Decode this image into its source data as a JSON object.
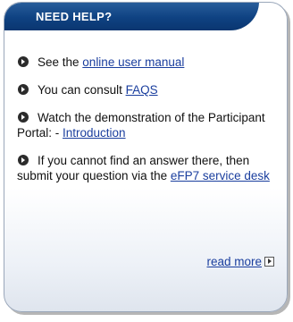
{
  "box": {
    "title": "NEED HELP?",
    "items": [
      {
        "text": "See the ",
        "link": "online user manual",
        "after": ""
      },
      {
        "text": "You can consult ",
        "link": "FAQS",
        "after": ""
      },
      {
        "text": "Watch the demonstration of the Participant Portal: - ",
        "link": "Introduction",
        "after": ""
      },
      {
        "text": "If you cannot find an answer there, then submit your question via the ",
        "link": "eFP7 service desk",
        "after": ""
      }
    ],
    "read_more": "read more"
  },
  "colors": {
    "header": "#0f4282",
    "link": "#1a3e9e",
    "border": "#9aa7ba"
  },
  "icons": {
    "bullet": "circle-arrow-icon",
    "read_more": "boxed-arrow-icon"
  }
}
